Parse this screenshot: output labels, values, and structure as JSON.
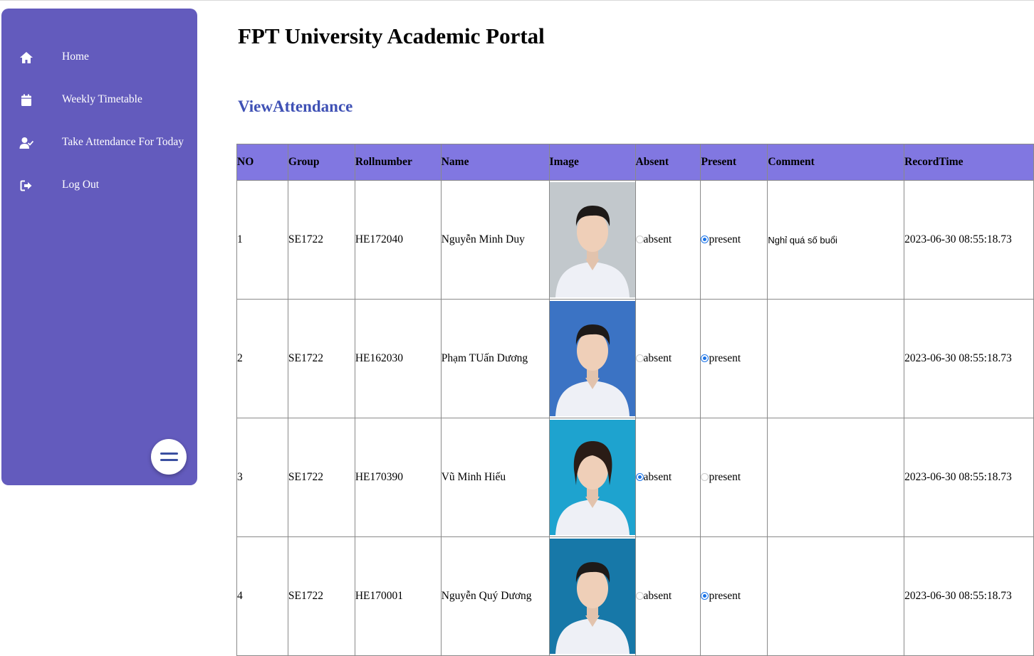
{
  "sidebar": {
    "items": [
      {
        "label": "Home",
        "icon": "home-icon"
      },
      {
        "label": "Weekly Timetable",
        "icon": "calendar-icon"
      },
      {
        "label": "Take Attendance For Today",
        "icon": "user-check-icon"
      },
      {
        "label": "Log Out",
        "icon": "sign-out-icon"
      }
    ],
    "toggle_icon": "menu-icon",
    "background": "#635bbd"
  },
  "page": {
    "title": "FPT University Academic Portal",
    "section_title": "ViewAttendance",
    "section_color": "#3f51b5"
  },
  "table": {
    "header_color": "#8177e1",
    "columns": [
      "NO",
      "Group",
      "Rollnumber",
      "Name",
      "Image",
      "Absent",
      "Present",
      "Comment",
      "RecordTime"
    ],
    "rows": [
      {
        "no": "1",
        "group": "SE1722",
        "roll": "HE172040",
        "name": "Nguyễn Minh Duy",
        "status": "present",
        "absent_label": "absent",
        "present_label": "present",
        "comment": "Nghỉ quá số buổi",
        "record_time": "2023-06-30 08:55:18.73",
        "photo_bg": "#c2c8cc"
      },
      {
        "no": "2",
        "group": "SE1722",
        "roll": "HE162030",
        "name": "Phạm TUấn Dương",
        "status": "present",
        "absent_label": "absent",
        "present_label": "present",
        "comment": "",
        "record_time": "2023-06-30 08:55:18.73",
        "photo_bg": "#3b73c4"
      },
      {
        "no": "3",
        "group": "SE1722",
        "roll": "HE170390",
        "name": "Vũ Minh Hiếu",
        "status": "absent",
        "absent_label": "absent",
        "present_label": "present",
        "comment": "",
        "record_time": "2023-06-30 08:55:18.73",
        "photo_bg": "#1ea3cf"
      },
      {
        "no": "4",
        "group": "SE1722",
        "roll": "HE170001",
        "name": "Nguyễn Quý Dương",
        "status": "present",
        "absent_label": "absent",
        "present_label": "present",
        "comment": "",
        "record_time": "2023-06-30 08:55:18.73",
        "photo_bg": "#1778a8"
      }
    ]
  }
}
